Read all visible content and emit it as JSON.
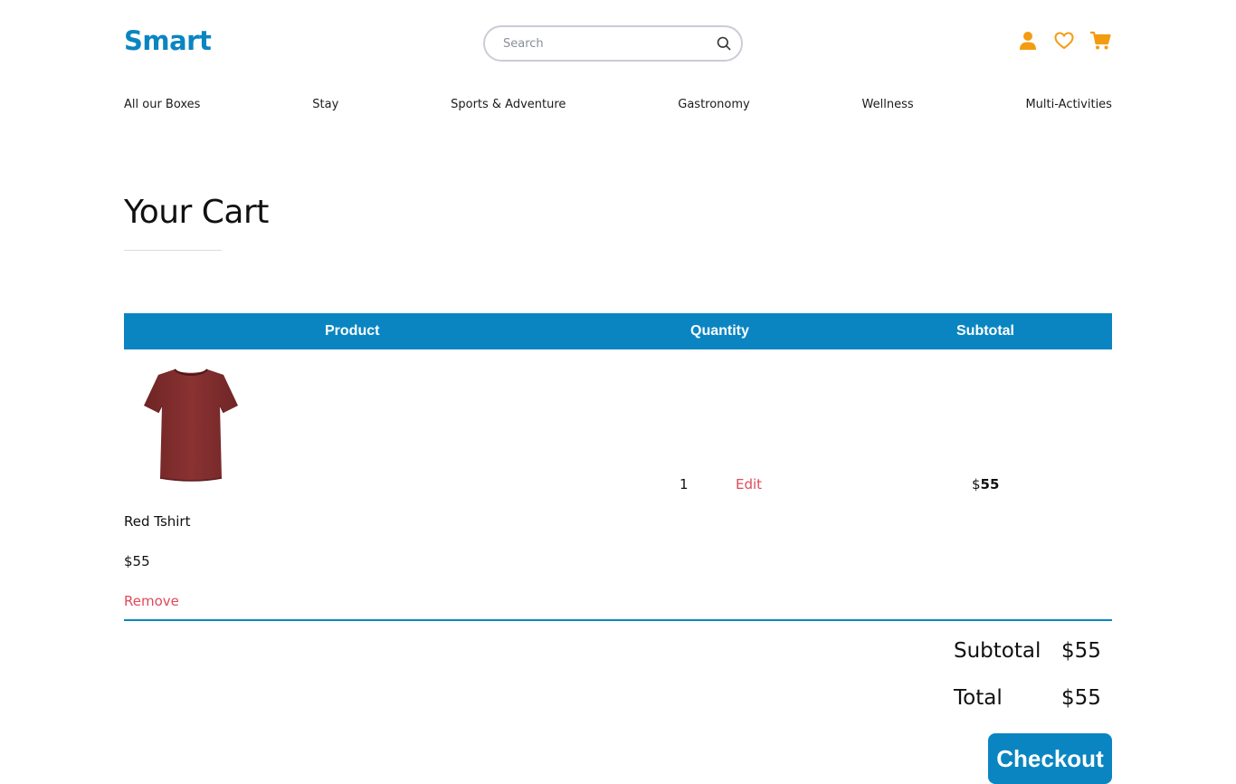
{
  "brand": {
    "logo_text": "Smart",
    "primary_color": "#0a85c2",
    "accent_color": "#f39c12",
    "danger_color": "#e04a5a"
  },
  "header": {
    "search": {
      "placeholder": "Search",
      "icon": "search-icon"
    },
    "icons": [
      "user-icon",
      "heart-icon",
      "cart-icon"
    ]
  },
  "nav": {
    "items": [
      {
        "label": "All our Boxes"
      },
      {
        "label": "Stay"
      },
      {
        "label": "Sports & Adventure"
      },
      {
        "label": "Gastronomy"
      },
      {
        "label": "Wellness"
      },
      {
        "label": "Multi-Activities"
      }
    ]
  },
  "page": {
    "title": "Your Cart"
  },
  "table": {
    "headers": {
      "product": "Product",
      "quantity": "Quantity",
      "subtotal": "Subtotal"
    },
    "rows": [
      {
        "image": "red-tshirt",
        "name": "Red Tshirt",
        "price": "$55",
        "remove_label": "Remove",
        "quantity": "1",
        "edit_label": "Edit",
        "subtotal_currency": "$",
        "subtotal_amount": "55"
      }
    ]
  },
  "summary": {
    "subtotal_label": "Subtotal",
    "subtotal_value": "$55",
    "total_label": "Total",
    "total_value": "$55"
  },
  "checkout_label": "Checkout"
}
